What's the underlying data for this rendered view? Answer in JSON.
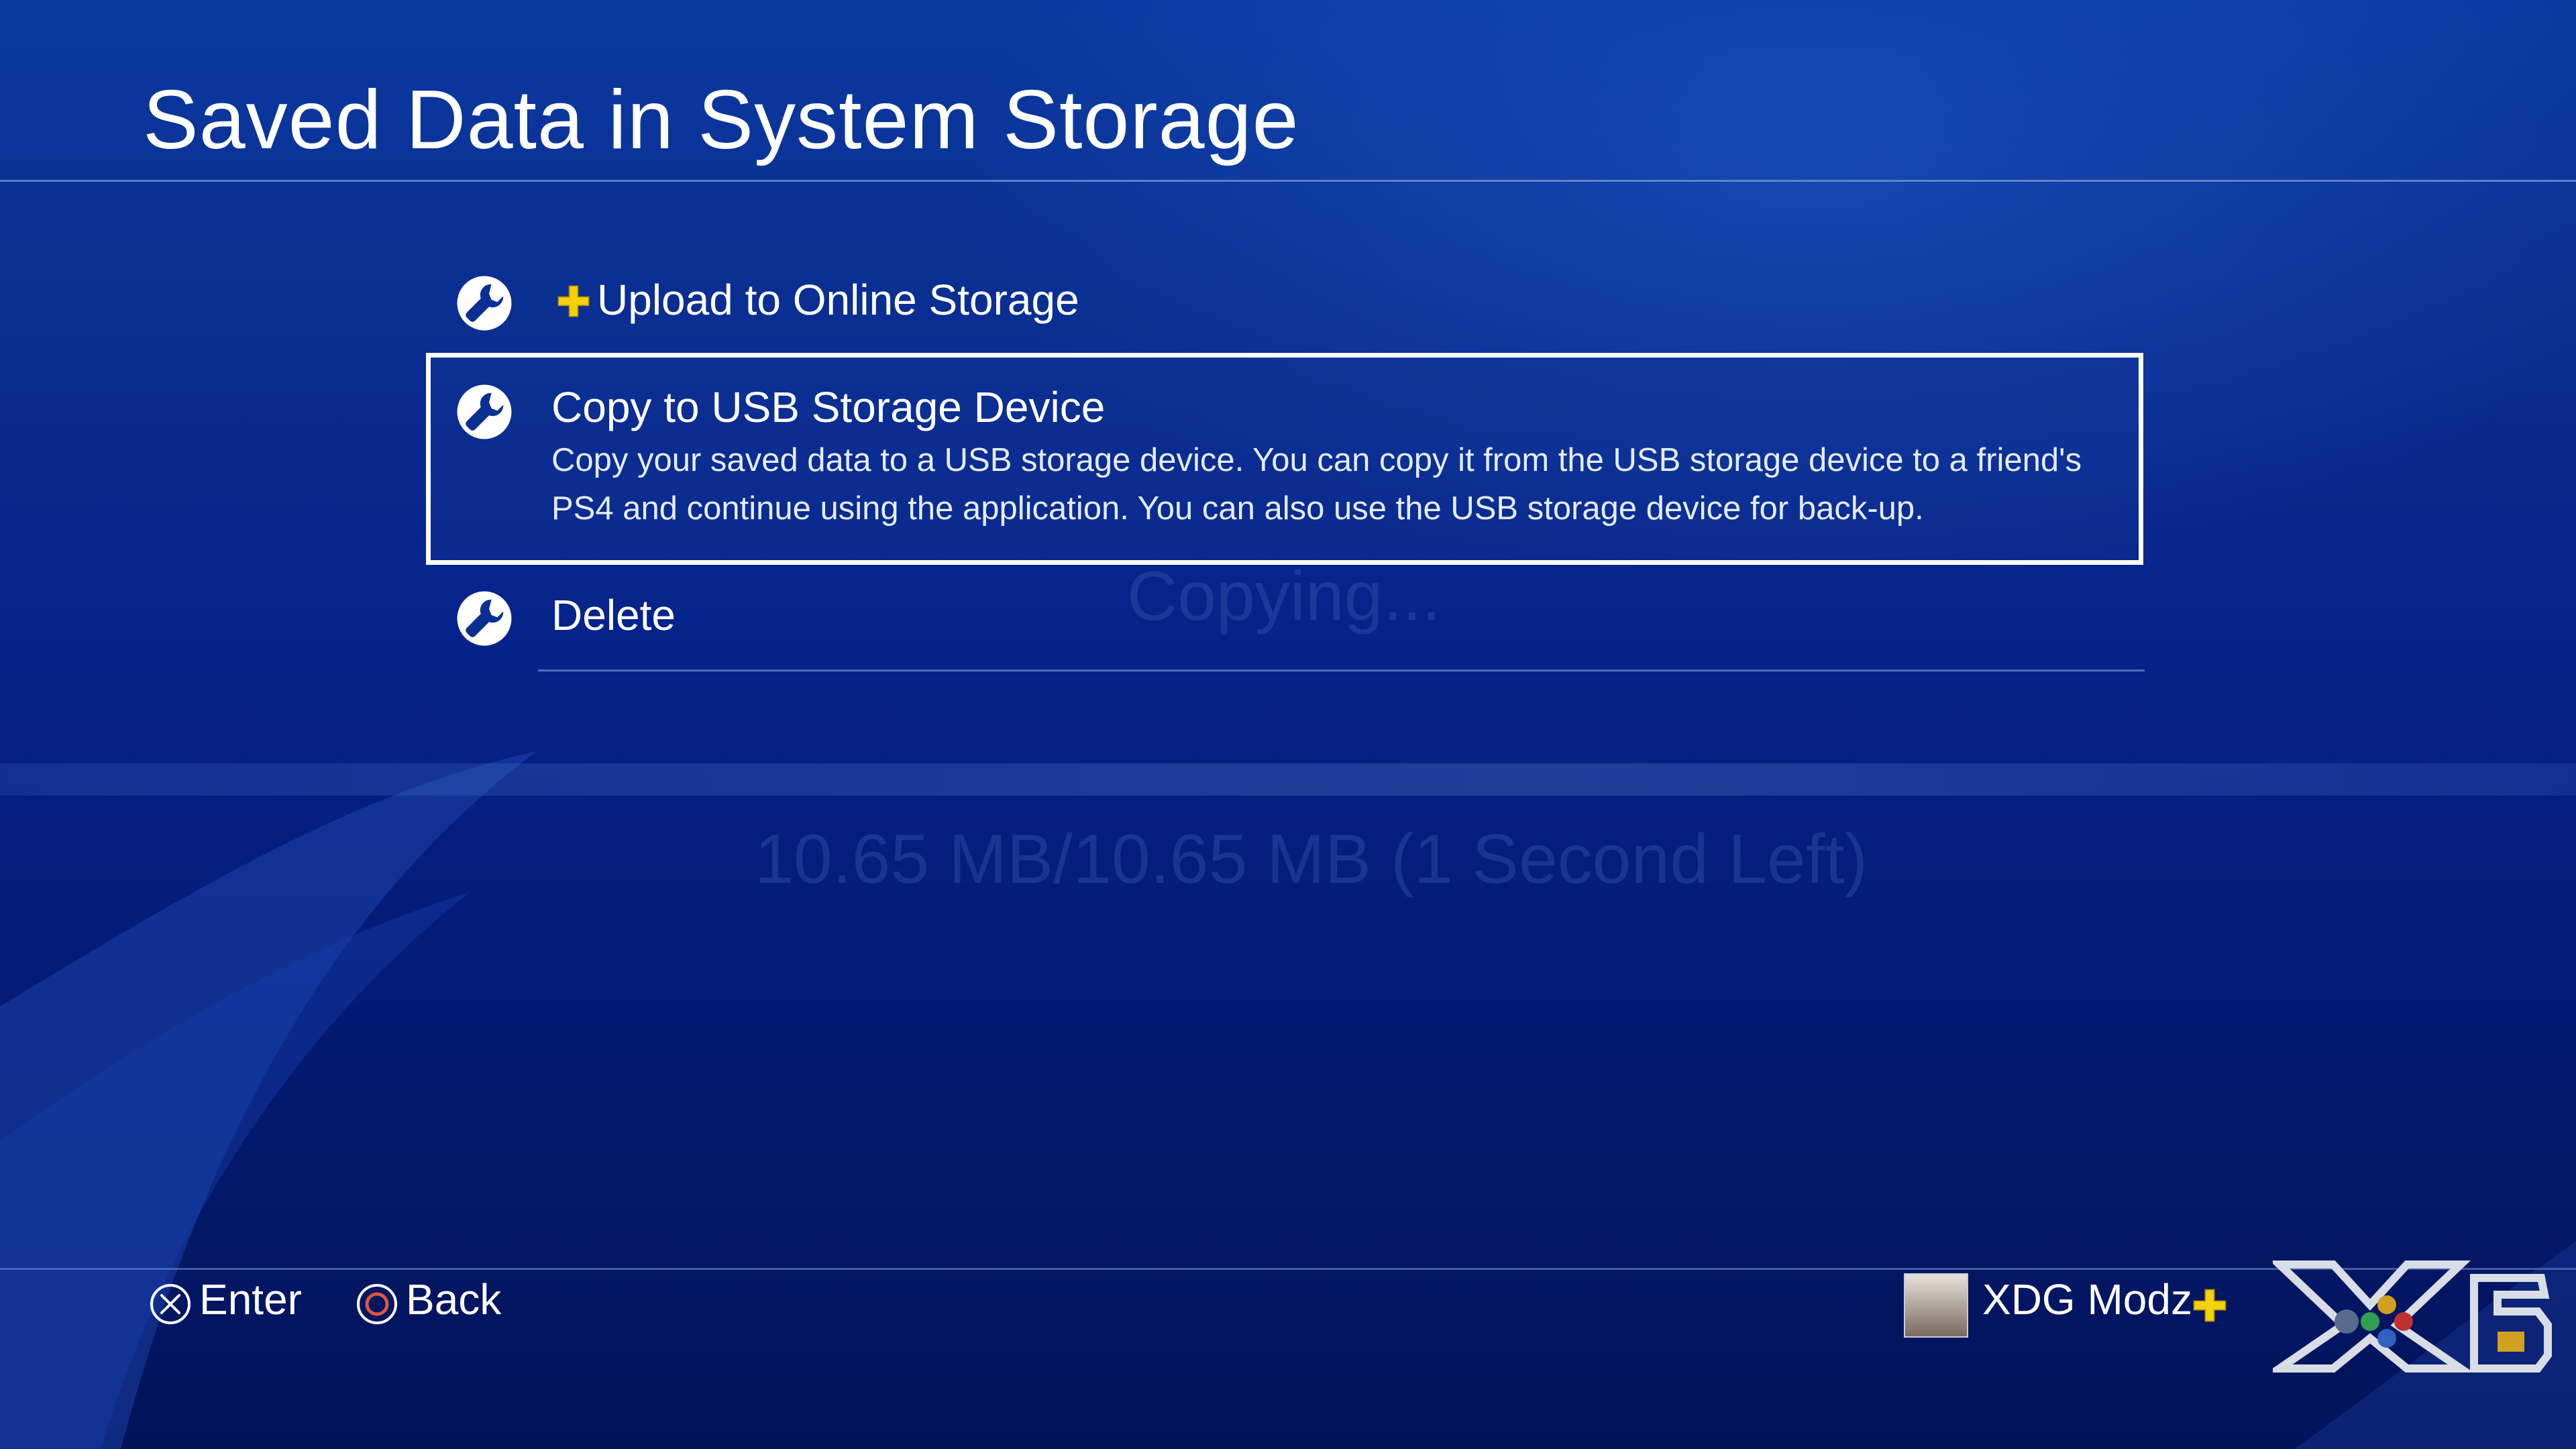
{
  "page": {
    "title": "Saved Data in System Storage"
  },
  "menu": {
    "items": [
      {
        "label": "Upload to Online Storage",
        "icon": "wrench-icon",
        "badge_icon": "ps-plus-icon",
        "selected": false
      },
      {
        "label": "Copy to USB Storage Device",
        "icon": "wrench-icon",
        "selected": true,
        "description": "Copy your saved data to a USB storage device. You can copy it from the USB storage device to a friend's PS4 and continue using the application. You can also use the USB storage device for back-up."
      },
      {
        "label": "Delete",
        "icon": "wrench-icon",
        "selected": false
      }
    ]
  },
  "background_dialog": {
    "status_text": "Copying...",
    "progress_text": "10.65 MB/10.65 MB (1 Second Left)"
  },
  "footer": {
    "enter_label": "Enter",
    "back_label": "Back",
    "enter_icon": "cross-button-icon",
    "back_icon": "circle-button-icon",
    "user_name": "XDG Modz",
    "user_plus_icon": "ps-plus-icon",
    "watermark_icon": "xdg-logo-icon"
  },
  "colors": {
    "background_top": "#0a39a0",
    "background_bottom": "#03135a",
    "selection_border": "#ffffff",
    "ps_plus_yellow": "#f5d10a",
    "circle_button": "#e0553a"
  }
}
